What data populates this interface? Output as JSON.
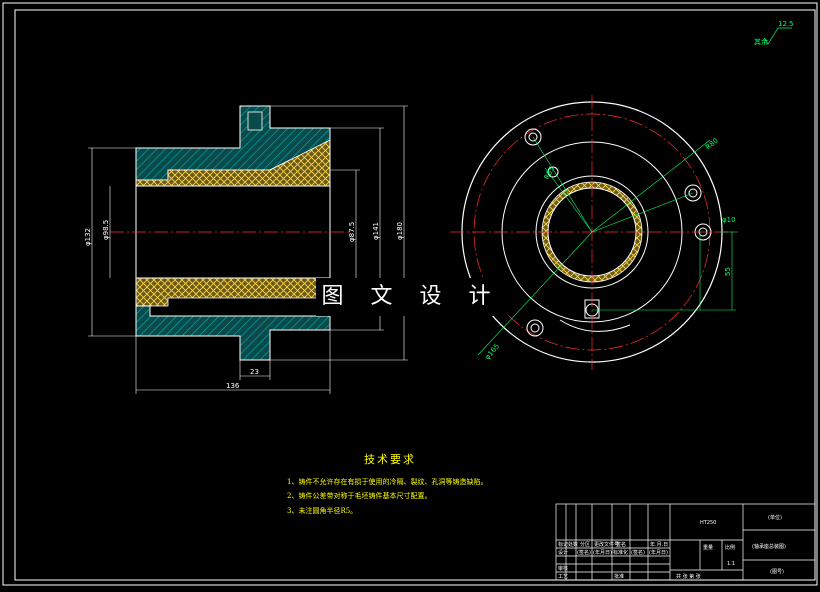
{
  "watermark": "图 文 设 计",
  "technical_requirements": {
    "title": "技术要求",
    "notes": [
      "1、铸件不允许存在有损于使用的冷隔、裂纹、孔洞等铸造缺陷。",
      "2、铸件公差带对称于毛坯铸件基本尺寸配置。",
      "3、未注圆角半径R5。"
    ]
  },
  "surface_finish": {
    "value": "12.5",
    "note": "其余"
  },
  "dimensions": {
    "left_view": {
      "phi132": "φ132",
      "phi98_5": "φ98.5",
      "phi87_5": "φ87.5",
      "phi141": "φ141",
      "phi180": "φ180",
      "len136": "136",
      "len23": "23"
    },
    "right_view": {
      "r80": "R80",
      "r85": "R85",
      "phi10": "φ10",
      "dim55": "55",
      "phi165": "φ165"
    }
  },
  "title_block": {
    "material": "HT250",
    "org": "(单位)",
    "part_name": "(轴承座总装图)",
    "drawing_no": "(图号)",
    "scale_label": "比例",
    "scale": "1:1",
    "weight_label": "重量",
    "sheet_info": "共 张 第 张",
    "rows": {
      "row1": [
        "标记",
        "处数",
        "分区",
        "更改文件号",
        "签名",
        "年.月.日"
      ],
      "row2": [
        "设计",
        "(签名)",
        "(年月日)",
        "标准化",
        "(签名)",
        "(年月日)"
      ],
      "row3": [
        "审核"
      ],
      "row4": [
        "工艺",
        "",
        "",
        "批准"
      ]
    },
    "stage_labels": [
      "阶段标记",
      "重量",
      "比例"
    ]
  }
}
